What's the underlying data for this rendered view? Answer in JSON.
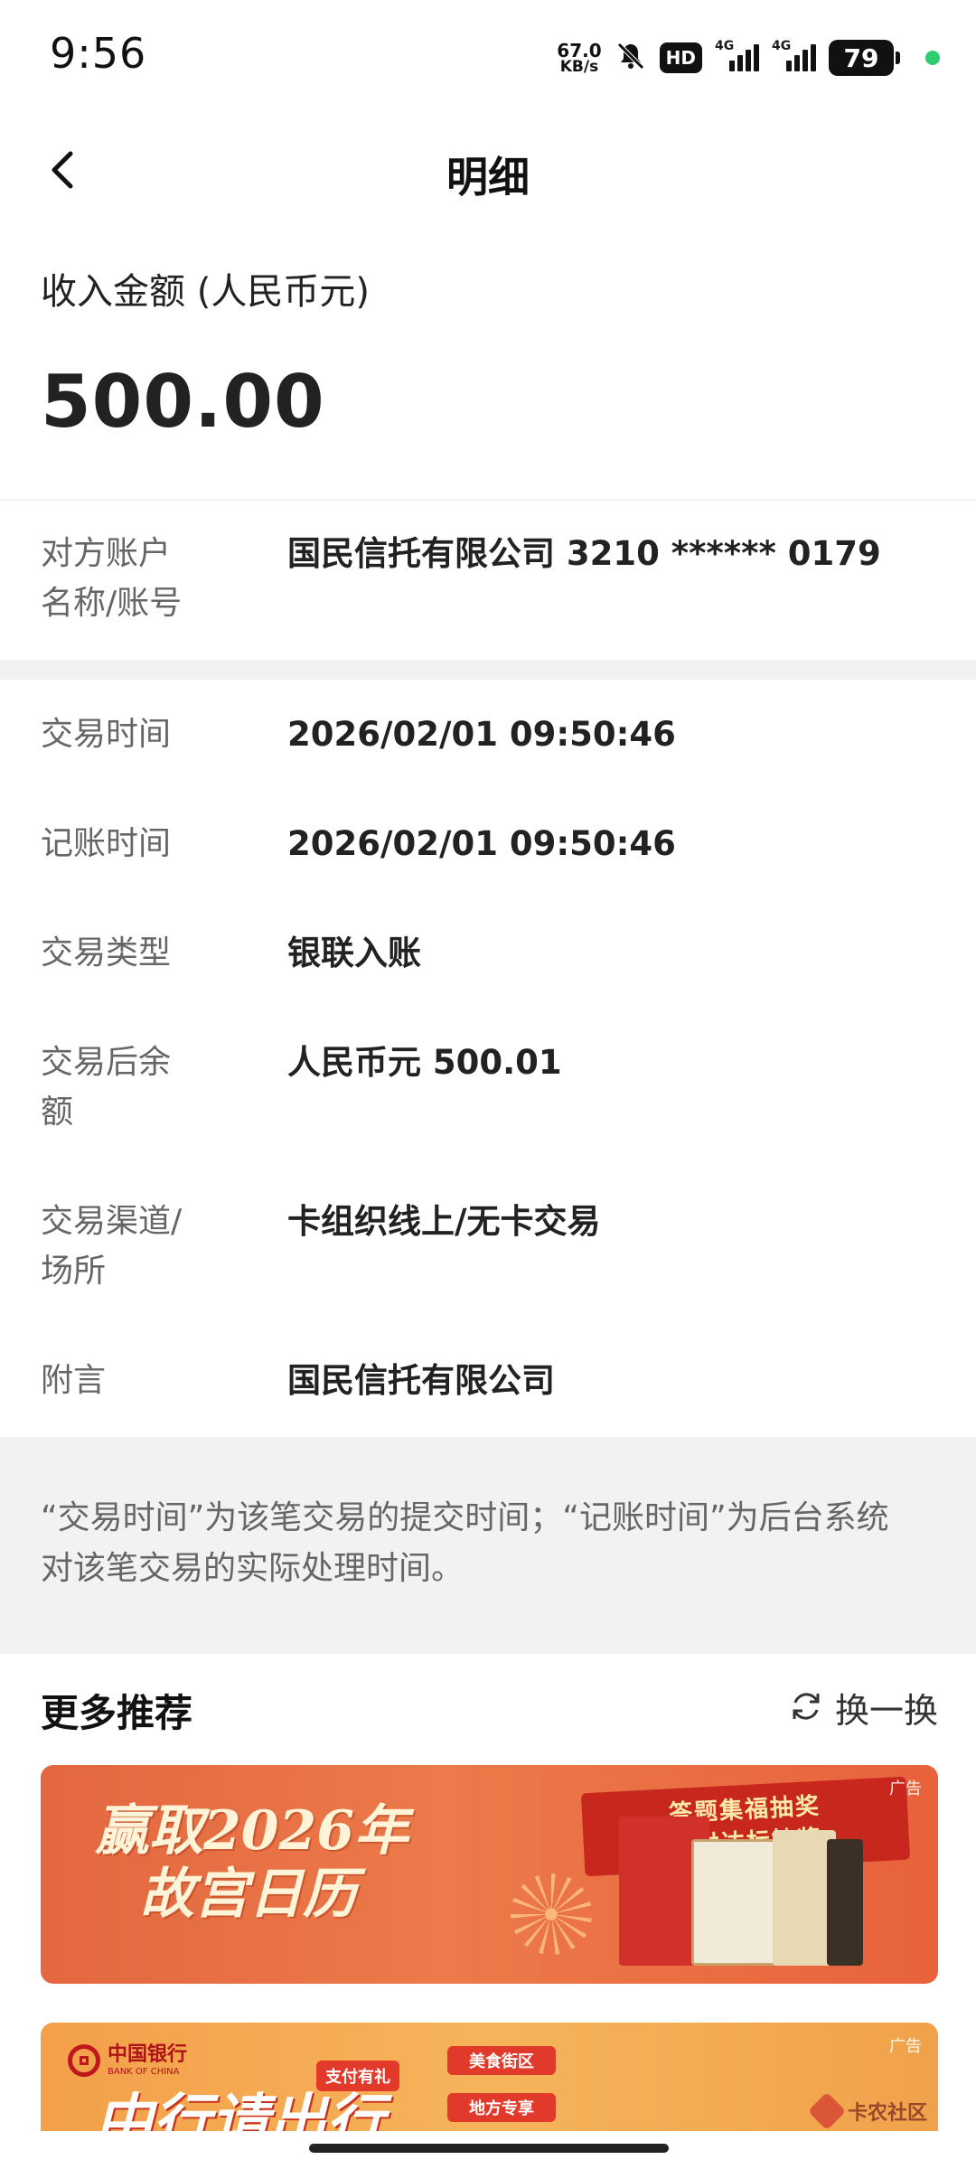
{
  "status_bar": {
    "time": "9:56",
    "net_speed_value": "67.0",
    "net_speed_unit": "KB/s",
    "hd": "HD",
    "sim1": "4G",
    "sim2": "4G",
    "battery": "79",
    "icons": [
      "mute-bell-icon",
      "signal-icon",
      "battery-icon"
    ]
  },
  "header": {
    "title": "明细"
  },
  "amount": {
    "label": "收入金额 (人民币元)",
    "value": "500.00"
  },
  "counterparty": {
    "label_line1": "对方账户",
    "label_line2": "名称/账号",
    "value": "国民信托有限公司 3210 ****** 0179"
  },
  "details": {
    "trade_time_label": "交易时间",
    "trade_time_value": "2026/02/01 09:50:46",
    "post_time_label": "记账时间",
    "post_time_value": "2026/02/01 09:50:46",
    "type_label": "交易类型",
    "type_value": "银联入账",
    "balance_label_line1": "交易后余",
    "balance_label_line2": "额",
    "balance_value": "人民币元 500.01",
    "channel_label_line1": "交易渠道/",
    "channel_label_line2": "场所",
    "channel_value": "卡组织线上/无卡交易",
    "remark_label": "附言",
    "remark_value": "国民信托有限公司"
  },
  "note": {
    "line1": "“交易时间”为该笔交易的提交时间；“记账时间”为后台系统",
    "line2": "对该笔交易的实际处理时间。"
  },
  "recommend": {
    "title": "更多推荐",
    "refresh_label": "换一换",
    "ad_tag": "广告",
    "banner1": {
      "headline_line1": "赢取2026年",
      "headline_line2": "故宫日历",
      "ribbon_line1": "答题集福抽奖",
      "ribbon_line2": "支付达标抽奖"
    },
    "banner2": {
      "logo_cn": "中国银行",
      "logo_en": "BANK OF CHINA",
      "pill_a": "支付有礼",
      "pill_b": "美食街区",
      "pill_c": "地方专享",
      "big_text": "中行请出行",
      "watermark": "卡农社区"
    }
  },
  "colors": {
    "accent_red": "#c8271e",
    "text_primary": "#222222",
    "text_secondary": "#666666",
    "divider_gray": "#f2f2f2"
  }
}
